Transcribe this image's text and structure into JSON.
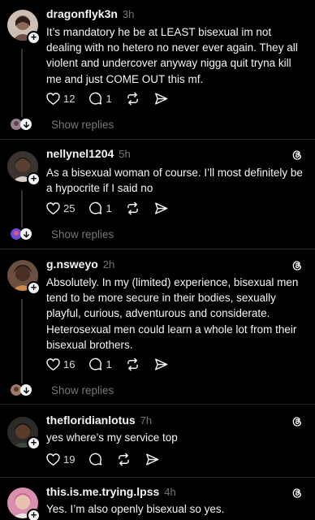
{
  "colors": {
    "background": "#000000",
    "text": "#f3f5f7",
    "muted": "#777777",
    "divider": "#262626"
  },
  "posts": [
    {
      "username": "dragonflyk3n",
      "time": "3h",
      "lines": [
        "It’s mandatory he be at LEAST bisexual im not",
        "dealing with no hetero no never ever again. They all",
        "violent and undercover anyway nigga quit tryna kill",
        "me and just COME OUT this mf."
      ],
      "likes": "12",
      "replies": "1",
      "show_replies": "Show replies"
    },
    {
      "username": "nellynel1204",
      "time": "5h",
      "lines": [
        "As a bisexual woman of course. I’ll most definitely be",
        "a hypocrite if I said no"
      ],
      "likes": "25",
      "replies": "1",
      "show_replies": "Show replies"
    },
    {
      "username": "g.nsweyo",
      "time": "2h",
      "lines": [
        "Absolutely. In my (limited) experience, bisexual men",
        "tend to be more secure in their bodies, sexually",
        "playful, curious, adventurous and considerate.",
        "Heterosexual men could learn a whole lot from their",
        "bisexual brothers."
      ],
      "likes": "16",
      "replies": "1",
      "show_replies": "Show replies"
    },
    {
      "username": "thefloridianlotus",
      "time": "7h",
      "lines": [
        "yes where’s my service top"
      ],
      "likes": "19"
    },
    {
      "username": "this.is.me.trying.lpss",
      "time": "4h",
      "lines": [
        "Yes. I’m also openly bisexual so yes."
      ]
    }
  ]
}
